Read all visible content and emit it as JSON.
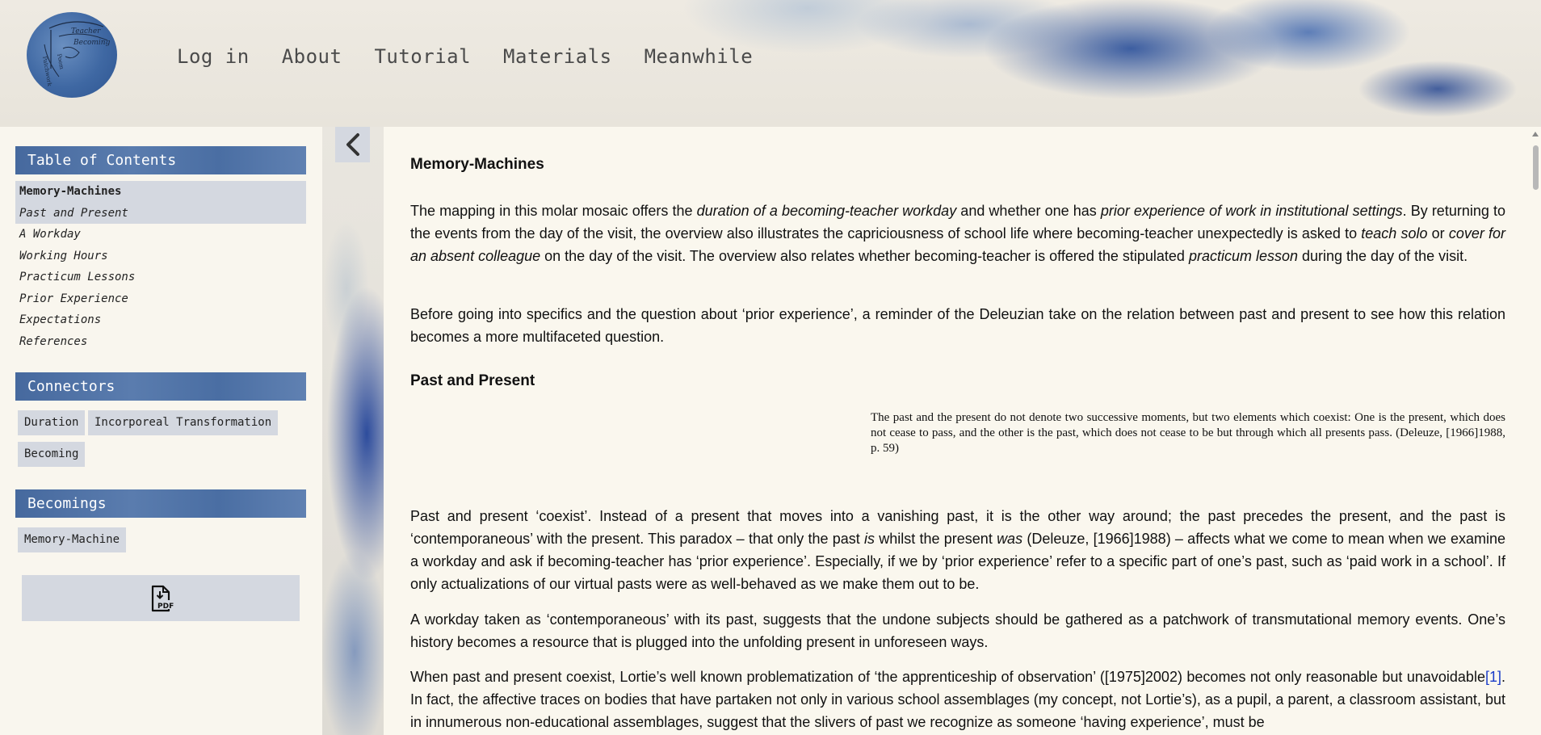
{
  "logo": {
    "text_lines": [
      "Teacher",
      "Becoming",
      "Patchwork",
      "Poem"
    ]
  },
  "nav": {
    "items": [
      "Log in",
      "About",
      "Tutorial",
      "Materials",
      "Meanwhile"
    ]
  },
  "sidebar": {
    "toc_title": "Table of Contents",
    "toc_items": [
      "Memory-Machines",
      "Past and Present",
      "A Workday",
      "Working Hours",
      "Practicum Lessons",
      "Prior Experience",
      "Expectations",
      "References"
    ],
    "connectors_title": "Connectors",
    "connectors": [
      "Duration",
      "Incorporeal Transformation",
      "Becoming"
    ],
    "becomings_title": "Becomings",
    "becomings": [
      "Memory-Machine"
    ],
    "pdf_icon": "pdf-file-icon",
    "pdf_label": "PDF"
  },
  "collapse_icon": "chevron-left-icon",
  "article": {
    "title": "Memory-Machines",
    "p1": {
      "a": "The mapping in this molar mosaic offers the ",
      "b": "duration of a becoming-teacher workday",
      "c": " and whether one has ",
      "d": "prior experience of work in institutional settings",
      "e": ". By returning to the events from the day of the visit, the overview also illustrates the capriciousness of school life where becoming-teacher unexpectedly is asked to ",
      "f": "teach solo",
      "g": " or ",
      "h": "cover for an absent colleague",
      "i": " on the day of the visit. The overview also relates whether becoming-teacher is offered the stipulated ",
      "j": "practicum lesson",
      "k": " during the day of the visit."
    },
    "p2": "Before going into specifics and the question about ‘prior experience’, a reminder of the Deleuzian take on the relation between past and present to see how this relation becomes a more multifaceted question.",
    "h_past": "Past and Present",
    "quote": "The past and the present do not denote two successive moments, but two elements which coexist: One is the present, which does not cease to pass, and the other is the past, which does not cease to be but through which all presents pass. (Deleuze, [1966]1988, p. 59)",
    "p3": {
      "a": "Past and present ‘coexist’. Instead of a present that moves into a vanishing past, it is the other way around; the past precedes the present, and the past is ‘contemporaneous’ with the present. This paradox – that only the past ",
      "b": "is",
      "c": " whilst the present ",
      "d": "was",
      "e": " (Deleuze, [1966]1988) – affects what we come to mean when we examine a workday and ask if becoming-teacher has ‘prior experience’. Especially, if we by ‘prior experience’ refer to a specific part of one’s past, such as ‘paid work in a school’. If only actualizations of our virtual pasts were as well-behaved as we make them out to be."
    },
    "p4": "A workday taken as ‘contemporaneous’ with its past, suggests that the undone subjects should be gathered as a patchwork of transmutational memory events. One’s history becomes a resource that is plugged into the unfolding present in unforeseen ways.",
    "p5": {
      "a": "When past and present coexist, Lortie’s well known problematization of ‘the apprenticeship of observation’ ([1975]2002) becomes not only reasonable but unavoidable",
      "fn": "[1]",
      "b": ". In fact, the affective traces on bodies that have partaken not only in various school assemblages (my concept, not Lortie’s), as a pupil, a parent, a classroom assistant, but in innumerous non-educational assemblages, suggest that the slivers of past we recognize as someone ‘having experience’, must be"
    }
  }
}
